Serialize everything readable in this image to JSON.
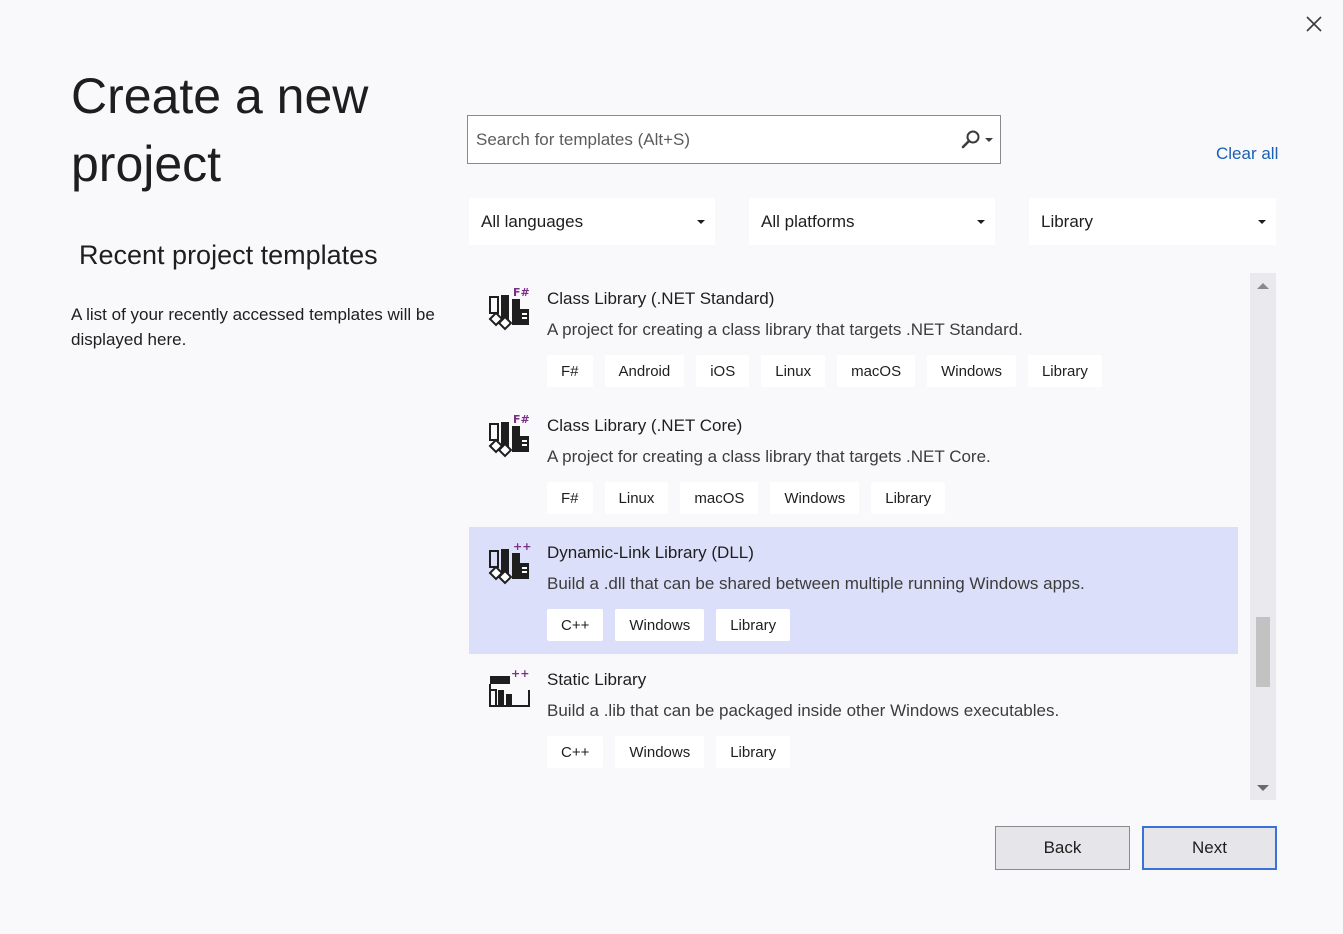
{
  "page": {
    "title": "Create a new project"
  },
  "recent": {
    "title": "Recent project templates",
    "description": "A list of your recently accessed templates will be displayed here."
  },
  "search": {
    "placeholder": "Search for templates (Alt+S)",
    "value": ""
  },
  "clear_all": "Clear all",
  "filters": {
    "language": "All languages",
    "platform": "All platforms",
    "project_type": "Library"
  },
  "templates": [
    {
      "name": "Class Library (.NET Standard)",
      "description": "A project for creating a class library that targets .NET Standard.",
      "lang_badge": "F#",
      "tags": [
        "F#",
        "Android",
        "iOS",
        "Linux",
        "macOS",
        "Windows",
        "Library"
      ],
      "icon": "fsharp-class-library-icon",
      "selected": false
    },
    {
      "name": "Class Library (.NET Core)",
      "description": "A project for creating a class library that targets .NET Core.",
      "lang_badge": "F#",
      "tags": [
        "F#",
        "Linux",
        "macOS",
        "Windows",
        "Library"
      ],
      "icon": "fsharp-class-library-icon",
      "selected": false
    },
    {
      "name": "Dynamic-Link Library (DLL)",
      "description": "Build a .dll that can be shared between multiple running Windows apps.",
      "lang_badge": "++",
      "tags": [
        "C++",
        "Windows",
        "Library"
      ],
      "icon": "cpp-dll-icon",
      "selected": true
    },
    {
      "name": "Static Library",
      "description": "Build a .lib that can be packaged inside other Windows executables.",
      "lang_badge": "++",
      "tags": [
        "C++",
        "Windows",
        "Library"
      ],
      "icon": "cpp-static-library-icon",
      "selected": false
    }
  ],
  "buttons": {
    "back": "Back",
    "next": "Next"
  },
  "colors": {
    "background": "#f9f9fb",
    "selected_row": "#dcdff9",
    "link": "#1a5fb4",
    "fsharp_accent": "#7a2f86",
    "cpp_accent": "#7a2f86",
    "primary_border": "#3874d8"
  }
}
